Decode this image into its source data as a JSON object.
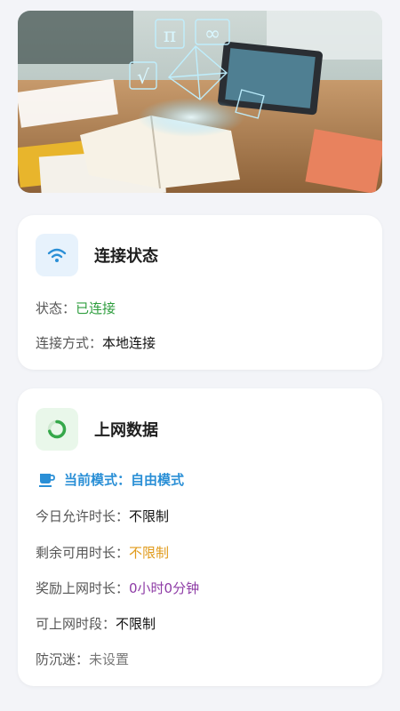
{
  "connection": {
    "title": "连接状态",
    "status_label": "状态：",
    "status_value": "已连接",
    "method_label": "连接方式：",
    "method_value": "本地连接",
    "status_color": "#2f9e3f"
  },
  "internet": {
    "title": "上网数据",
    "mode_label": "当前模式：",
    "mode_value": "自由模式",
    "mode_color": "#2a8fd6",
    "rows": [
      {
        "label": "今日允许时长：",
        "value": "不限制",
        "color": "#111111"
      },
      {
        "label": "剩余可用时长：",
        "value": "不限制",
        "color": "#e09a1a"
      },
      {
        "label": "奖励上网时长：",
        "value": "0小时0分钟",
        "color": "#8e3ca6"
      },
      {
        "label": "可上网时段：",
        "value": "不限制",
        "color": "#111111"
      },
      {
        "label": "防沉迷：",
        "value": "未设置",
        "color": "#777777"
      }
    ]
  },
  "icons": {
    "connection": "wifi-icon",
    "internet": "data-ring-icon",
    "mode": "coffee-cup-icon"
  },
  "hero": {
    "formula_symbols": [
      "π",
      "∞",
      "√"
    ]
  }
}
